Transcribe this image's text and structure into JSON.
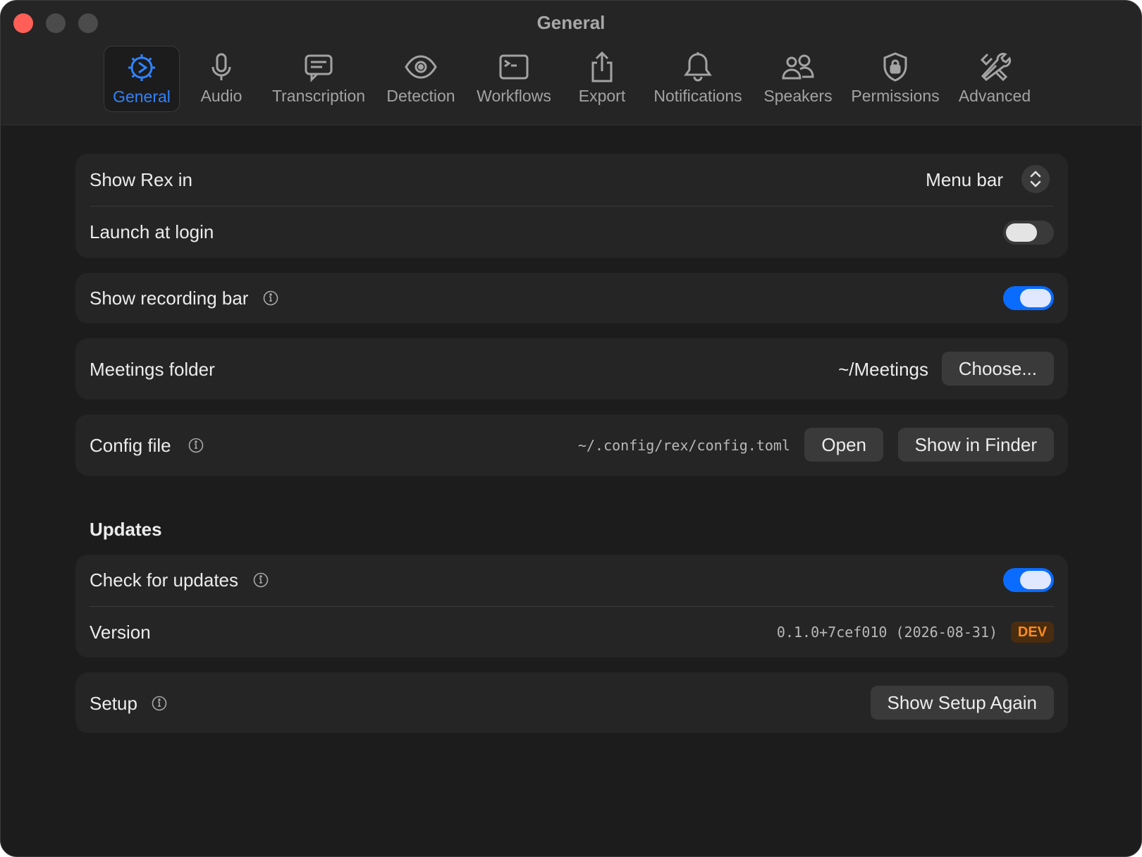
{
  "window": {
    "title": "General"
  },
  "tabs": [
    {
      "label": "General",
      "icon": "gear-icon",
      "active": true
    },
    {
      "label": "Audio",
      "icon": "microphone-icon",
      "active": false
    },
    {
      "label": "Transcription",
      "icon": "speech-bubble-icon",
      "active": false
    },
    {
      "label": "Detection",
      "icon": "eye-icon",
      "active": false
    },
    {
      "label": "Workflows",
      "icon": "terminal-icon",
      "active": false
    },
    {
      "label": "Export",
      "icon": "share-icon",
      "active": false
    },
    {
      "label": "Notifications",
      "icon": "bell-icon",
      "active": false
    },
    {
      "label": "Speakers",
      "icon": "people-icon",
      "active": false
    },
    {
      "label": "Permissions",
      "icon": "lock-shield-icon",
      "active": false
    },
    {
      "label": "Advanced",
      "icon": "tools-icon",
      "active": false
    }
  ],
  "settings": {
    "show_rex_in": {
      "label": "Show Rex in",
      "value": "Menu bar"
    },
    "launch_at_login": {
      "label": "Launch at login",
      "enabled": false
    },
    "show_recording_bar": {
      "label": "Show recording bar",
      "enabled": true
    },
    "meetings_folder": {
      "label": "Meetings folder",
      "value": "~/Meetings",
      "button": "Choose..."
    },
    "config_file": {
      "label": "Config file",
      "value": "~/.config/rex/config.toml",
      "open_button": "Open",
      "finder_button": "Show in Finder"
    }
  },
  "updates": {
    "section_title": "Updates",
    "check_for_updates": {
      "label": "Check for updates",
      "enabled": true
    },
    "version": {
      "label": "Version",
      "value": "0.1.0+7cef010 (2026-08-31)",
      "badge": "DEV"
    }
  },
  "setup": {
    "label": "Setup",
    "button": "Show Setup Again"
  },
  "colors": {
    "accent": "#2f82ff",
    "toggle_on": "#0a6cff",
    "badge_text": "#ff8c1a",
    "close_button": "#ff5f57"
  }
}
